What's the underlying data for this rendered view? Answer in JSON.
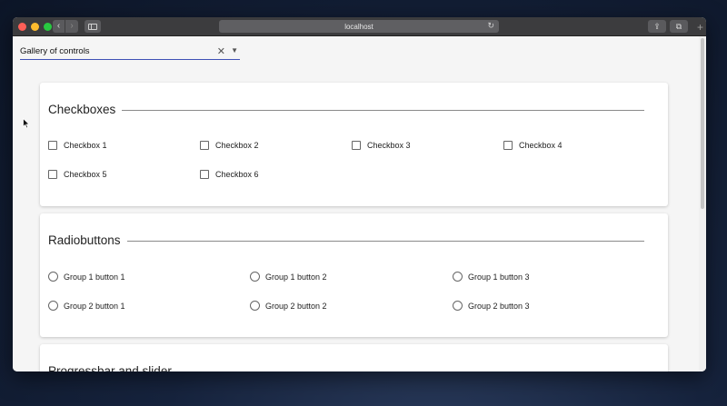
{
  "browser": {
    "url": "localhost",
    "back_glyph": "‹",
    "forward_glyph": "›",
    "reload_glyph": "↻",
    "share_glyph": "⇪",
    "tabs_glyph": "⧉",
    "newtab_glyph": "+"
  },
  "top_input": {
    "value": "Gallery of controls",
    "clear_glyph": "✕",
    "caret_glyph": "▼"
  },
  "checkboxes": {
    "title": "Checkboxes",
    "items": [
      "Checkbox 1",
      "Checkbox 2",
      "Checkbox 3",
      "Checkbox 4",
      "Checkbox 5",
      "Checkbox 6"
    ]
  },
  "radiobuttons": {
    "title": "Radiobuttons",
    "items": [
      "Group 1 button 1",
      "Group 1 button 2",
      "Group 1 button 3",
      "Group 2 button 1",
      "Group 2 button 2",
      "Group 2 button 3"
    ]
  },
  "progressbar": {
    "title": "Progressbar and slider"
  },
  "colors": {
    "accent": "#3f51b5",
    "titlebar": "#3c3c3e"
  }
}
